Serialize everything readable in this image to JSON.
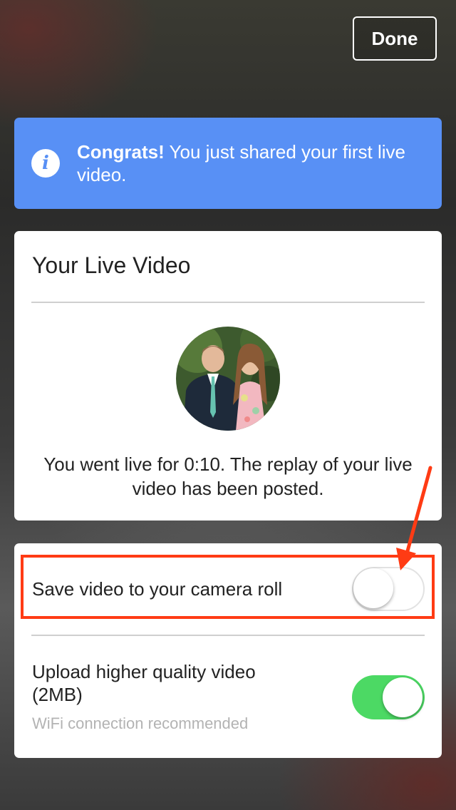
{
  "header": {
    "done_label": "Done"
  },
  "banner": {
    "icon": "info-icon",
    "bold_text": "Congrats!",
    "text": " You just shared your first live video."
  },
  "live_card": {
    "title": "Your Live Video",
    "avatar": "couple-photo",
    "message": "You went live for 0:10. The replay of your live video has been posted."
  },
  "settings": {
    "save_label": "Save video to your camera roll",
    "save_enabled": false,
    "upload_label_line1": "Upload higher quality video",
    "upload_label_line2": "(2MB)",
    "upload_sublabel": "WiFi connection recommended",
    "upload_enabled": true
  },
  "annotation": {
    "color": "#ff3b14"
  },
  "colors": {
    "banner": "#5890f5",
    "toggle_on": "#4cd964"
  }
}
